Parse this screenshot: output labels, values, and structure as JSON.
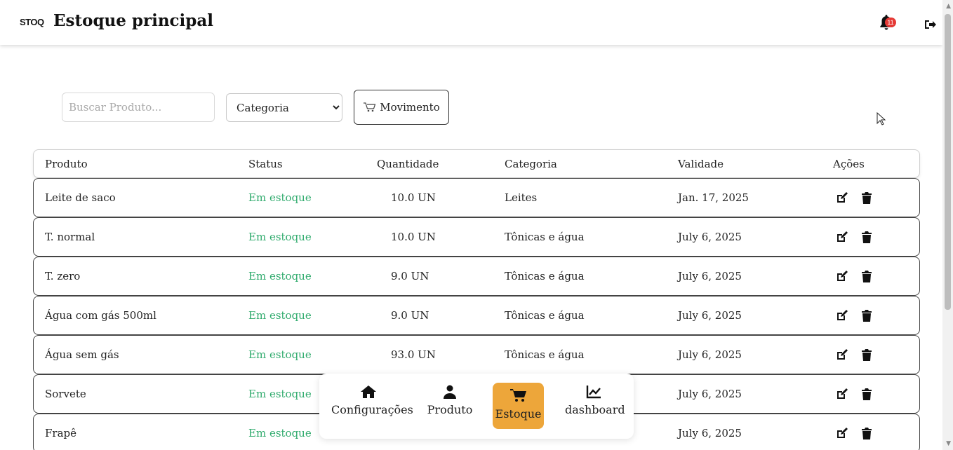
{
  "header": {
    "logo_text": "STOQ",
    "title": "Estoque principal",
    "notification_count": "11",
    "icons": [
      "bell-icon",
      "logout-icon"
    ]
  },
  "toolbar": {
    "search_placeholder": "Buscar Produto...",
    "category_selected": "Categoria",
    "movement_label": "Movimento",
    "movement_icon": "cart-icon"
  },
  "table": {
    "columns": [
      "Produto",
      "Status",
      "Quantidade",
      "Categoria",
      "Validade",
      "Ações"
    ],
    "rows": [
      {
        "produto": "Leite de saco",
        "status": "Em estoque",
        "quantidade": "10.0 UN",
        "categoria": "Leites",
        "validade": "Jan. 17, 2025"
      },
      {
        "produto": "T. normal",
        "status": "Em estoque",
        "quantidade": "10.0 UN",
        "categoria": "Tônicas e água",
        "validade": "July 6, 2025"
      },
      {
        "produto": "T. zero",
        "status": "Em estoque",
        "quantidade": "9.0 UN",
        "categoria": "Tônicas e água",
        "validade": "July 6, 2025"
      },
      {
        "produto": "Água com gás 500ml",
        "status": "Em estoque",
        "quantidade": "9.0 UN",
        "categoria": "Tônicas e água",
        "validade": "July 6, 2025"
      },
      {
        "produto": "Água sem gás",
        "status": "Em estoque",
        "quantidade": "93.0 UN",
        "categoria": "Tônicas e água",
        "validade": "July 6, 2025"
      },
      {
        "produto": "Sorvete",
        "status": "Em estoque",
        "quantidade": "",
        "categoria": "",
        "validade": "July 6, 2025"
      },
      {
        "produto": "Frapê",
        "status": "Em estoque",
        "quantidade": "",
        "categoria": "",
        "validade": "July 6, 2025"
      }
    ],
    "status_color": "#2eaa6c"
  },
  "bottom_nav": {
    "items": [
      {
        "label": "Configurações",
        "icon": "home-icon"
      },
      {
        "label": "Produto",
        "icon": "user-icon"
      },
      {
        "label": "Estoque",
        "icon": "cart-icon",
        "active": true
      },
      {
        "label": "dashboard",
        "icon": "chart-line-icon"
      }
    ],
    "active_color": "#eda63a"
  }
}
